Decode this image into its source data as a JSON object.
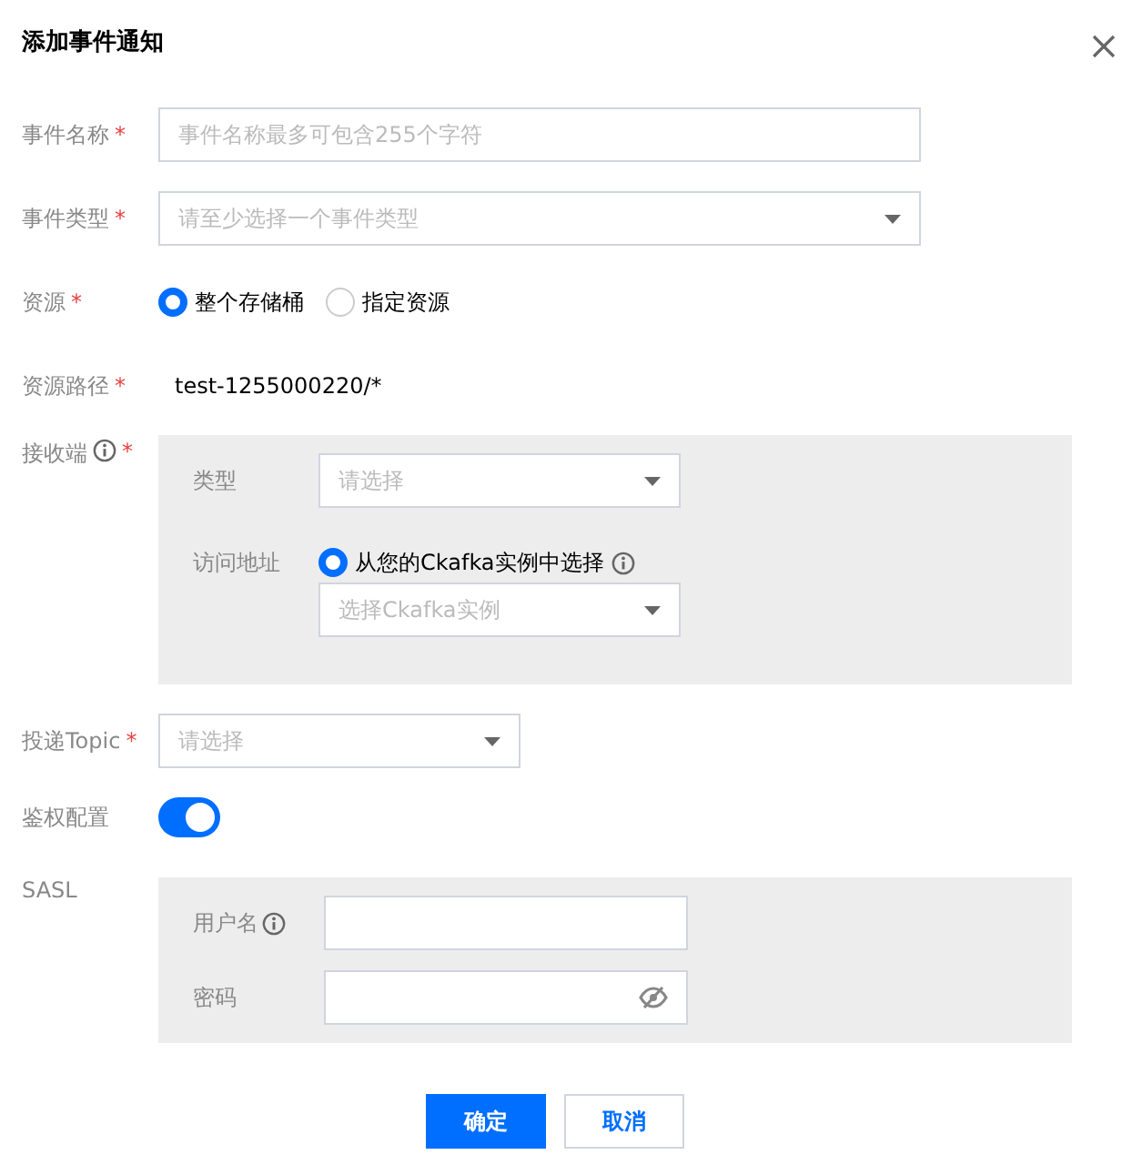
{
  "dialog": {
    "title": "添加事件通知"
  },
  "fields": [
    {
      "kind": "input",
      "label": "事件名称",
      "required_mark": "*",
      "placeholder": "事件名称最多可包含255个字符"
    },
    {
      "kind": "select",
      "label": "事件类型",
      "required_mark": "*",
      "placeholder": "请至少选择一个事件类型"
    },
    {
      "kind": "radio",
      "label": "资源",
      "required_mark": "*",
      "options": [
        {
          "label": "整个存储桶",
          "selected": true
        },
        {
          "label": "指定资源",
          "selected": false
        }
      ]
    },
    {
      "kind": "text",
      "label": "资源路径",
      "required_mark": "*",
      "value": "test-1255000220/*"
    },
    {
      "kind": "panel",
      "label": "接收端",
      "required_mark": "*",
      "info": true,
      "rows": [
        {
          "kind": "select",
          "label": "类型",
          "placeholder": "请选择"
        },
        {
          "kind": "radio-select",
          "label": "访问地址",
          "option": {
            "label": "从您的Ckafka实例中选择",
            "selected": true,
            "info": true
          },
          "placeholder": "选择Ckafka实例"
        }
      ]
    },
    {
      "kind": "short-select",
      "label": "投递Topic",
      "required_mark": "*",
      "placeholder": "请选择"
    },
    {
      "kind": "switch",
      "label": "鉴权配置",
      "on": true
    },
    {
      "kind": "panel",
      "label": "SASL",
      "rows": [
        {
          "kind": "input",
          "label": "用户名",
          "info": true
        },
        {
          "kind": "password",
          "label": "密码"
        }
      ]
    }
  ],
  "buttons": [
    {
      "label": "确定",
      "kind": "primary"
    },
    {
      "label": "取消",
      "kind": "secondary"
    }
  ]
}
